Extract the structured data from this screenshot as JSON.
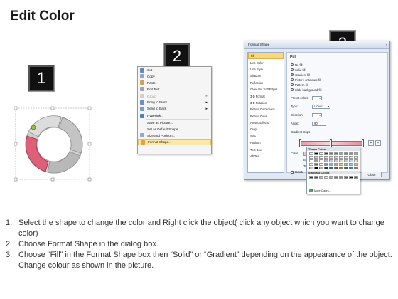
{
  "title": "Edit Color",
  "badges": [
    "1",
    "2",
    "3"
  ],
  "colors": {
    "accent_pink": "#e7667b",
    "shape_gray": "#c9c9c9",
    "selection_green": "#8bc43f"
  },
  "context_menu": {
    "items": [
      {
        "label": "Cut",
        "icon": "scissors-icon"
      },
      {
        "label": "Copy",
        "icon": "copy-icon"
      },
      {
        "label": "Paste",
        "icon": "paste-icon"
      },
      {
        "label": "Edit Text",
        "icon": "edit-text-icon"
      },
      {
        "label": "Group",
        "icon": "group-icon",
        "submenu": true,
        "disabled": true
      },
      {
        "label": "Bring to Front",
        "icon": "bring-front-icon",
        "submenu": true
      },
      {
        "label": "Send to Back",
        "icon": "send-back-icon",
        "submenu": true
      },
      {
        "label": "Hyperlink...",
        "icon": "hyperlink-icon"
      },
      {
        "label": "Save as Picture...",
        "icon": ""
      },
      {
        "label": "Set as Default Shape",
        "icon": ""
      },
      {
        "label": "Size and Position...",
        "icon": "size-icon"
      },
      {
        "label": "Format Shape...",
        "icon": "format-shape-icon",
        "highlight": true
      }
    ]
  },
  "dialog": {
    "title": "Format Shape",
    "nav": [
      "Fill",
      "Line Color",
      "Line Style",
      "Shadow",
      "Reflection",
      "Glow and Soft Edges",
      "3-D Format",
      "3-D Rotation",
      "Picture Corrections",
      "Picture Color",
      "Artistic Effects",
      "Crop",
      "Size",
      "Position",
      "Text Box",
      "Alt Text"
    ],
    "section": "Fill",
    "fill_options": [
      "No fill",
      "Solid fill",
      "Gradient fill",
      "Picture or texture fill",
      "Pattern fill",
      "Slide background fill"
    ],
    "preset_label": "Preset colors:",
    "type_label": "Type:",
    "type_value": "Linear",
    "direction_label": "Direction:",
    "angle_label": "Angle:",
    "angle_value": "90°",
    "stops_label": "Gradient stops",
    "color_label": "Color",
    "position_label": "Position:",
    "position_value": "0%",
    "brightness_label": "Brightness:",
    "transparency_label": "Transparency:",
    "rotate_label": "Rotate",
    "close_label": "Close"
  },
  "palette": {
    "theme_title": "Theme Colors",
    "standard_title": "Standard Colors",
    "more_label": "More Colors...",
    "theme_colors": [
      "#ffffff",
      "#000000",
      "#eeece1",
      "#1f497d",
      "#4f81bd",
      "#c0504d",
      "#9bbb59",
      "#8064a2",
      "#4bacc6",
      "#f79646"
    ],
    "standard_colors": [
      "#c00000",
      "#ff0000",
      "#ffc000",
      "#ffff00",
      "#92d050",
      "#00b050",
      "#00b0f0",
      "#0070c0",
      "#002060",
      "#7030a0"
    ]
  },
  "instructions": [
    {
      "num": "1.",
      "text": "Select the shape to change the color and Right click the object( click any object which you want to change color)"
    },
    {
      "num": "2.",
      "text": "Choose Format Shape in the dialog box."
    },
    {
      "num": "3.",
      "text": "Choose “Fill” in the Format Shape box then “Solid” or “Gradient” depending on the appearance of the object. Change colour as shown in the picture."
    }
  ]
}
